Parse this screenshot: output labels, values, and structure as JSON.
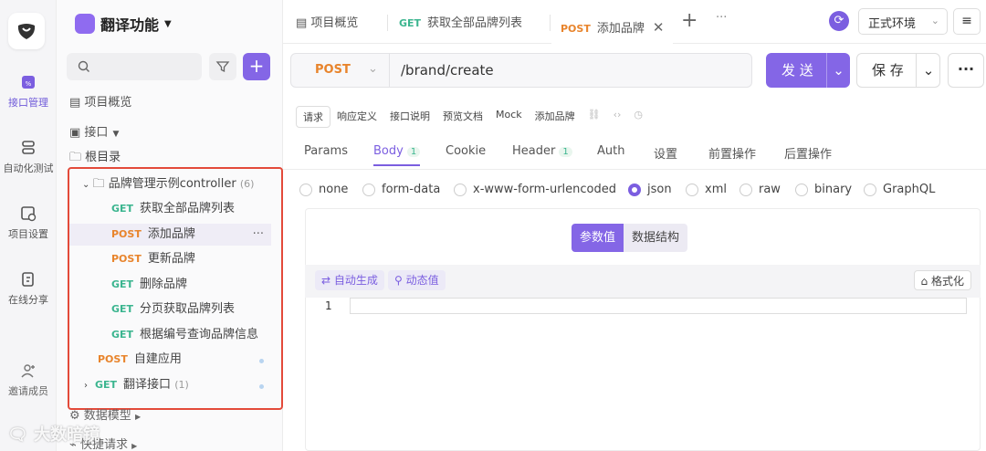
{
  "rail": {
    "items": [
      {
        "label": "接口管理",
        "icon": "api-icon",
        "active": true
      },
      {
        "label": "自动化测试",
        "icon": "automation-icon",
        "active": false
      },
      {
        "label": "项目设置",
        "icon": "project-settings-icon",
        "active": false
      },
      {
        "label": "在线分享",
        "icon": "share-icon",
        "active": false
      },
      {
        "label": "邀请成员",
        "icon": "invite-member-icon",
        "active": false
      }
    ]
  },
  "sidebar": {
    "project_name": "翻译功能",
    "overview": "项目概览",
    "api_section": "接口",
    "root": "根目录",
    "folder": "品牌管理示例controller",
    "folder_count": "(6)",
    "items": [
      {
        "method": "GET",
        "label": "获取全部品牌列表"
      },
      {
        "method": "POST",
        "label": "添加品牌",
        "more": "···"
      },
      {
        "method": "POST",
        "label": "更新品牌"
      },
      {
        "method": "GET",
        "label": "删除品牌"
      },
      {
        "method": "GET",
        "label": "分页获取品牌列表"
      },
      {
        "method": "GET",
        "label": "根据编号查询品牌信息"
      }
    ],
    "self_app": {
      "method": "POST",
      "label": "自建应用"
    },
    "translate": {
      "method": "GET",
      "label": "翻译接口",
      "count": "(1)"
    },
    "data_model": "数据模型",
    "quick_request": "快捷请求"
  },
  "tabs": [
    {
      "label": "项目概览"
    },
    {
      "method": "GET",
      "label": "获取全部品牌列表"
    },
    {
      "method": "POST",
      "label": "添加品牌"
    }
  ],
  "topbar": {
    "env": "正式环境"
  },
  "request": {
    "method": "POST",
    "url": "/brand/create",
    "send": "发 送",
    "save": "保 存"
  },
  "subtabs": [
    "请求",
    "响应定义",
    "接口说明",
    "预览文档",
    "Mock",
    "添加品牌"
  ],
  "req_tabs": [
    {
      "label": "Params"
    },
    {
      "label": "Body",
      "count": "1"
    },
    {
      "label": "Cookie"
    },
    {
      "label": "Header",
      "count": "1"
    },
    {
      "label": "Auth"
    },
    {
      "label": "设置"
    },
    {
      "label": "前置操作"
    },
    {
      "label": "后置操作"
    }
  ],
  "body_types": [
    "none",
    "form-data",
    "x-www-form-urlencoded",
    "json",
    "xml",
    "raw",
    "binary",
    "GraphQL"
  ],
  "body_type_selected": "json",
  "seg": {
    "values": "参数值",
    "schema": "数据结构"
  },
  "editor": {
    "auto": "自动生成",
    "dynamic": "动态值",
    "format": "格式化",
    "line1": "1"
  },
  "watermark": "大数暗镜",
  "colors": {
    "accent": "#8466e6",
    "get": "#3bb58f",
    "post": "#e8842c",
    "highlight": "#e34a3a"
  }
}
